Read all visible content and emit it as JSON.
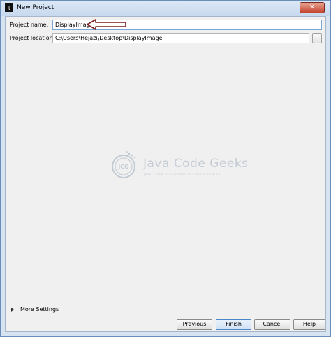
{
  "window": {
    "title": "New Project",
    "app_icon_text": "IJ",
    "close_glyph": "✕"
  },
  "form": {
    "project_name_label": "Project name:",
    "project_name_value": "DisplayImage",
    "project_location_label": "Project location:",
    "project_location_value": "C:\\Users\\Hejazi\\Desktop\\DisplayImage",
    "browse_label": "..."
  },
  "watermark": {
    "logo_text": "JCG",
    "title": "Java Code Geeks",
    "tagline": "JAVA 2 JAVA DEVELOPERS RESOURCE CENTER"
  },
  "more_settings": {
    "label": "More Settings"
  },
  "buttons": {
    "previous": "Previous",
    "finish": "Finish",
    "cancel": "Cancel",
    "help": "Help"
  },
  "colors": {
    "annotation_arrow": "#7b1c1c",
    "title_bar": "#c7d9ee",
    "focus_border": "#7aa7d8",
    "close_button": "#c4452f"
  }
}
